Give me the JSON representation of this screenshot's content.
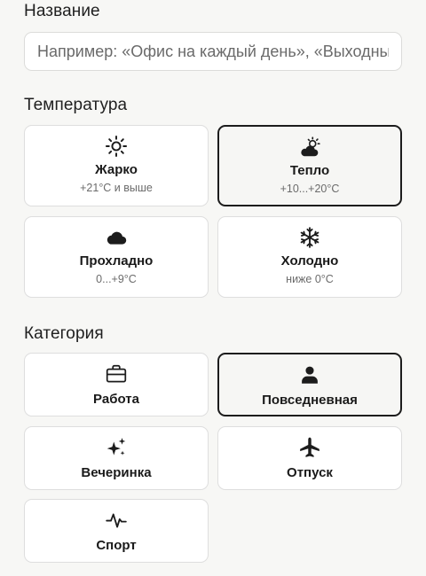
{
  "name": {
    "label": "Название",
    "placeholder": "Например: «Офис на каждый день», «Выходные»"
  },
  "temperature": {
    "label": "Температура",
    "options": [
      {
        "title": "Жарко",
        "range": "+21°C и выше",
        "icon": "sun-icon",
        "selected": false
      },
      {
        "title": "Тепло",
        "range": "+10...+20°C",
        "icon": "sun-behind-cloud-icon",
        "selected": true
      },
      {
        "title": "Прохладно",
        "range": "0...+9°C",
        "icon": "cloud-icon",
        "selected": false
      },
      {
        "title": "Холодно",
        "range": "ниже 0°C",
        "icon": "snowflake-icon",
        "selected": false
      }
    ]
  },
  "category": {
    "label": "Категория",
    "options": [
      {
        "title": "Работа",
        "icon": "briefcase-icon",
        "selected": false
      },
      {
        "title": "Повседневная",
        "icon": "person-icon",
        "selected": true
      },
      {
        "title": "Вечеринка",
        "icon": "sparkles-icon",
        "selected": false
      },
      {
        "title": "Отпуск",
        "icon": "airplane-icon",
        "selected": false
      },
      {
        "title": "Спорт",
        "icon": "heartbeat-icon",
        "selected": false
      }
    ]
  },
  "colors": {
    "background": "#f7f7f5",
    "card": "#ffffff",
    "selected_border": "#1c1c1c",
    "text": "#1a1a1a",
    "muted": "#6b6b6b"
  }
}
